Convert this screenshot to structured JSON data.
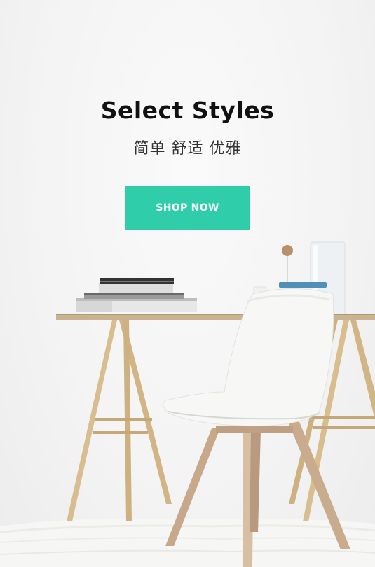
{
  "hero": {
    "title": "Select Styles",
    "subtitle": "简单 舒适 优雅",
    "cta_label": "SHOP NOW",
    "accent_color": "#30cdaa"
  },
  "scene": {
    "items": [
      "desk-photo",
      "white-chair",
      "book-stack",
      "glass-vase",
      "rug"
    ]
  }
}
